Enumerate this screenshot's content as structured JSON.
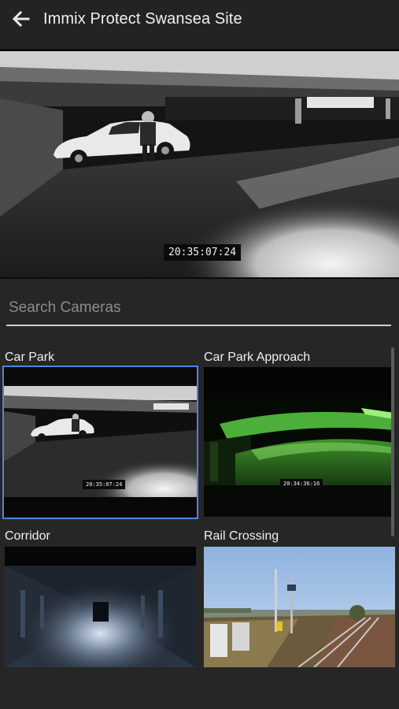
{
  "header": {
    "title": "Immix Protect Swansea Site",
    "back_icon": "arrow-left-icon"
  },
  "main_feed": {
    "timestamp": "20:35:07:24"
  },
  "search": {
    "placeholder": "Search Cameras",
    "value": ""
  },
  "cameras": [
    {
      "label": "Car Park",
      "timestamp": "20:35:07:24",
      "selected": true
    },
    {
      "label": "Car Park Approach",
      "timestamp": "20:34:36:16",
      "selected": false
    },
    {
      "label": "Corridor",
      "timestamp": "",
      "selected": false
    },
    {
      "label": "Rail Crossing",
      "timestamp": "",
      "selected": false
    }
  ],
  "colors": {
    "background": "#262626",
    "header": "#232323",
    "selected_outline": "#4a86e8",
    "search_underline": "#cfcfcf"
  }
}
